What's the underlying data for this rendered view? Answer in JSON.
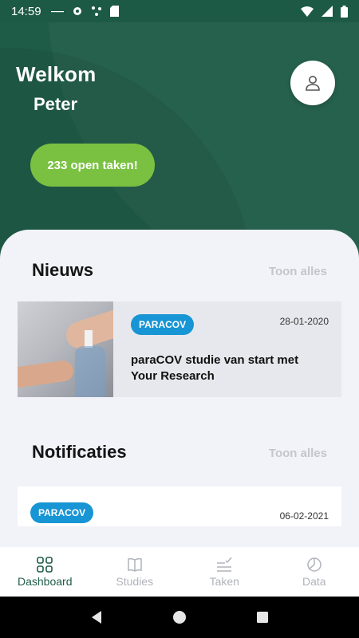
{
  "status_bar": {
    "time": "14:59",
    "left_icons": [
      "dots-icon",
      "gear-icon",
      "hub-icon",
      "sim-card-icon"
    ],
    "right_icons": [
      "wifi-icon",
      "signal-icon",
      "battery-icon"
    ]
  },
  "header": {
    "welcome": "Welkom",
    "username": "Peter",
    "open_tasks_label": "233 open taken!",
    "avatar_icon": "user-icon"
  },
  "news": {
    "title": "Nieuws",
    "show_all": "Toon alles",
    "items": [
      {
        "tag": "PARACOV",
        "date": "28-01-2020",
        "title": "paraCOV studie van start met Your Research",
        "image": "hand-sanitizer-image"
      }
    ]
  },
  "notifications": {
    "title": "Notificaties",
    "show_all": "Toon alles",
    "items": [
      {
        "tag": "PARACOV",
        "date": "06-02-2021"
      }
    ]
  },
  "bottom_nav": {
    "active": "Dashboard",
    "items": [
      {
        "label": "Dashboard",
        "icon": "grid-icon"
      },
      {
        "label": "Studies",
        "icon": "book-icon"
      },
      {
        "label": "Taken",
        "icon": "checklist-icon"
      },
      {
        "label": "Data",
        "icon": "pie-chart-icon"
      }
    ]
  },
  "colors": {
    "header_green": "#1f5c47",
    "accent_green": "#7ac142",
    "tag_blue": "#1795d4",
    "muted_text": "#c4c6cc"
  }
}
